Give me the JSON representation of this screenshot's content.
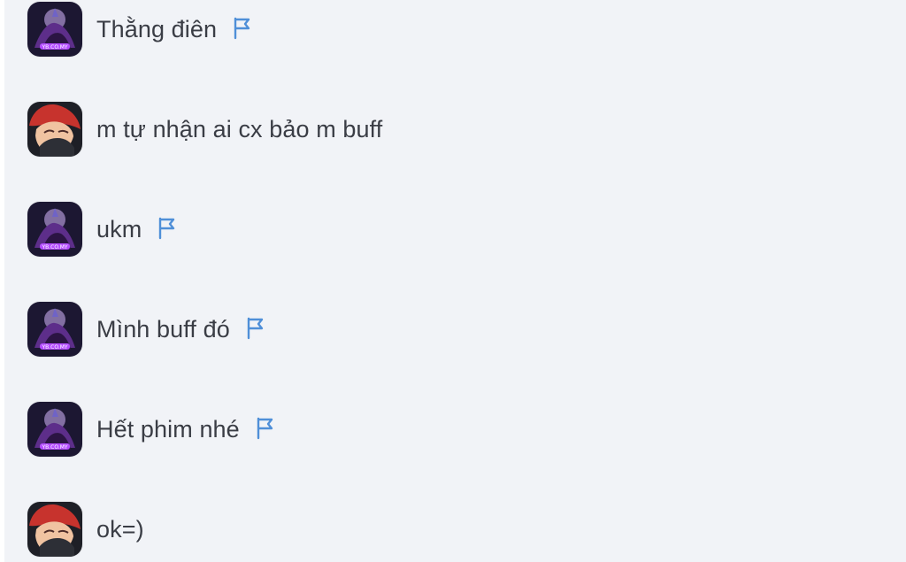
{
  "messages": [
    {
      "text": "Thằng điên",
      "avatar_icon": "purple-warrior-avatar-icon",
      "flag_icon": "flag-icon",
      "has_flag": true
    },
    {
      "text": "m tự nhận ai cx bảo m buff",
      "avatar_icon": "red-hair-avatar-icon",
      "flag_icon": "",
      "has_flag": false
    },
    {
      "text": "ukm",
      "avatar_icon": "purple-warrior-avatar-icon",
      "flag_icon": "flag-icon",
      "has_flag": true
    },
    {
      "text": "Mình buff đó",
      "avatar_icon": "purple-warrior-avatar-icon",
      "flag_icon": "flag-icon",
      "has_flag": true
    },
    {
      "text": "Hết phim nhé",
      "avatar_icon": "purple-warrior-avatar-icon",
      "flag_icon": "flag-icon",
      "has_flag": true
    },
    {
      "text": "ok=)",
      "avatar_icon": "red-hair-avatar-icon",
      "flag_icon": "",
      "has_flag": false
    }
  ],
  "colors": {
    "background": "#f1f3f7",
    "text": "#3a3d45",
    "flag": "#4f8fd8"
  }
}
